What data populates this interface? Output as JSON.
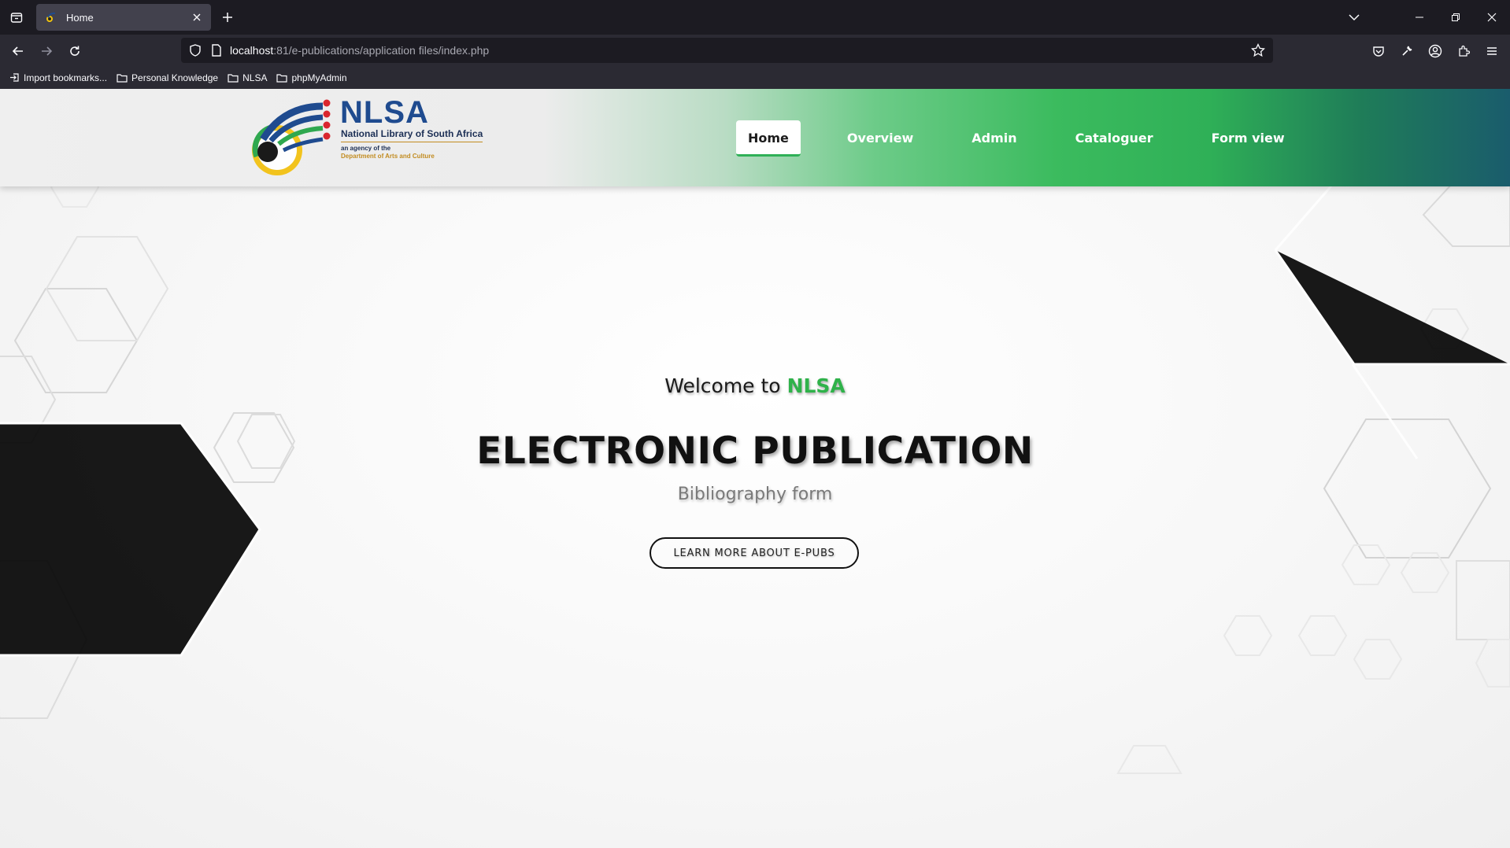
{
  "browser": {
    "tab_title": "Home",
    "url_host": "localhost",
    "url_path": ":81/e-publications/application files/index.php",
    "bookmarks": [
      "Import bookmarks...",
      "Personal Knowledge",
      "NLSA",
      "phpMyAdmin"
    ]
  },
  "site": {
    "logo": {
      "word": "NLSA",
      "full_name": "National Library of South Africa",
      "agency": "an agency of the",
      "department": "Department of Arts and Culture"
    },
    "nav": [
      {
        "label": "Home",
        "active": true
      },
      {
        "label": "Overview",
        "active": false
      },
      {
        "label": "Admin",
        "active": false
      },
      {
        "label": "Cataloguer",
        "active": false
      },
      {
        "label": "Form view",
        "active": false
      }
    ]
  },
  "hero": {
    "welcome_prefix": "Welcome to ",
    "welcome_brand": "NLSA",
    "title": "ELECTRONIC PUBLICATION",
    "subtitle": "Bibliography form",
    "button_label": "LEARN MORE ABOUT E-PUBS"
  },
  "colors": {
    "accent_green": "#2fb24a",
    "header_gradient_end": "#1a5c6c",
    "browser_dark": "#1c1b22"
  }
}
